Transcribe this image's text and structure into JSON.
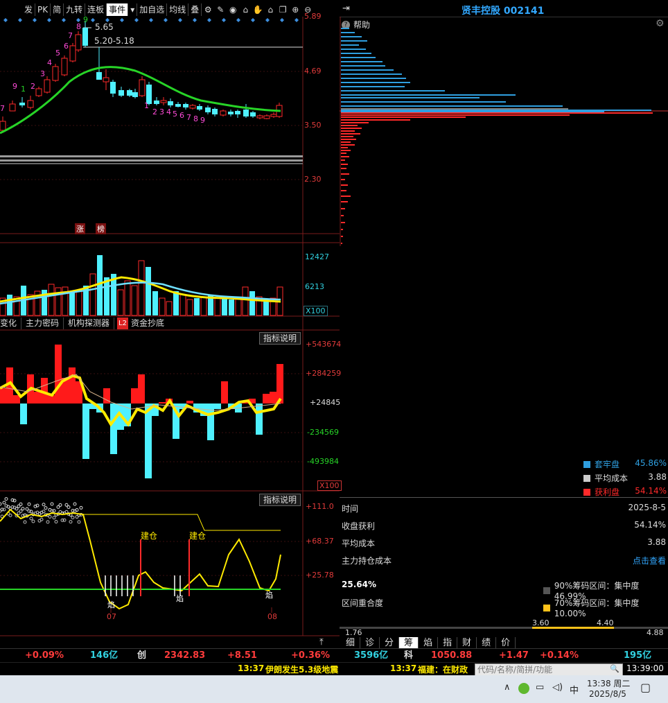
{
  "toolbar": {
    "items": [
      "发",
      "PK",
      "简",
      "九转",
      "连板",
      "事件",
      "加自选",
      "均线",
      "叠"
    ]
  },
  "main_axis": [
    "5.89",
    "4.69",
    "3.50",
    "2.30"
  ],
  "price_annot": {
    "high": "5.65",
    "range": "5.20-5.18"
  },
  "nine_seq_up": [
    "6",
    "7",
    "9",
    "1",
    "2",
    "3",
    "4",
    "5",
    "6",
    "7",
    "8",
    "9"
  ],
  "nine_seq_down": [
    "1",
    "2",
    "3",
    "4",
    "5",
    "6",
    "7",
    "8",
    "9"
  ],
  "event_tags": [
    "涨",
    "榜"
  ],
  "vol_axis": [
    "12427",
    "6213"
  ],
  "vol_unit": "X100",
  "ind_tabs": [
    "变化",
    "主力密码",
    "机构探测器",
    "资金抄底"
  ],
  "ind_tab_badge": "L2",
  "explain": "指标说明",
  "fund_axis": [
    "+543674",
    "+284259",
    "+24845",
    "-234569",
    "-493984"
  ],
  "fund_unit": "X100",
  "osc_axis": [
    "+111.0",
    "+68.37",
    "+25.78"
  ],
  "osc_labels": {
    "jian1": "建仓",
    "jian2": "建仓",
    "yan1": "焰",
    "yan2": "焰",
    "yan3": "焰"
  },
  "x_months": [
    "07",
    "08"
  ],
  "right": {
    "title": "贤丰控股 002141",
    "help": "帮助",
    "legend": [
      {
        "label": "套牢盘",
        "value": "45.86%",
        "color": "#2f9fe0"
      },
      {
        "label": "平均成本",
        "value": "3.88",
        "color": "#cccccc"
      },
      {
        "label": "获利盘",
        "value": "54.14%",
        "color": "#ff2a2a"
      }
    ],
    "rows": [
      {
        "k": "时间",
        "v": "2025-8-5"
      },
      {
        "k": "收盘获利",
        "v": "54.14%"
      },
      {
        "k": "平均成本",
        "v": "3.88"
      },
      {
        "k": "主力持仓成本",
        "v": "点击查看"
      }
    ],
    "pct": "25.64%",
    "overlap": "区间重合度",
    "range90": "90%筹码区间：集中度46.99%",
    "range70": "70%筹码区间：集中度10.00%",
    "scale": {
      "min": "1.76",
      "a": "3.60",
      "b": "4.40",
      "max": "4.88"
    },
    "tabs": [
      "细",
      "诊",
      "分",
      "筹",
      "焰",
      "指",
      "财",
      "绩",
      "价"
    ]
  },
  "ticker": [
    {
      "t": "+0.09%",
      "c": "#ff3b3b"
    },
    {
      "t": "146亿",
      "c": "#32d1e0"
    },
    {
      "t": "创",
      "c": "#ddd"
    },
    {
      "t": "2342.83",
      "c": "#ff3b3b"
    },
    {
      "t": "+8.51",
      "c": "#ff3b3b"
    },
    {
      "t": "+0.36%",
      "c": "#ff3b3b"
    },
    {
      "t": "3596亿",
      "c": "#32d1e0"
    },
    {
      "t": "科",
      "c": "#ddd"
    },
    {
      "t": "1050.88",
      "c": "#ff3b3b"
    },
    {
      "t": "+1.47",
      "c": "#ff3b3b"
    },
    {
      "t": "+0.14%",
      "c": "#ff3b3b"
    },
    {
      "t": "195亿",
      "c": "#32d1e0"
    }
  ],
  "news": [
    {
      "time": "13:37",
      "text": "伊朗发生5.3级地震"
    },
    {
      "time": "13:37",
      "text": "福建：在财政"
    }
  ],
  "search_placeholder": "代码/名称/简拼/功能",
  "clock": "13:39:00",
  "taskbar": {
    "ime": "中",
    "time": "13:38 周二",
    "date": "2025/8/5"
  }
}
